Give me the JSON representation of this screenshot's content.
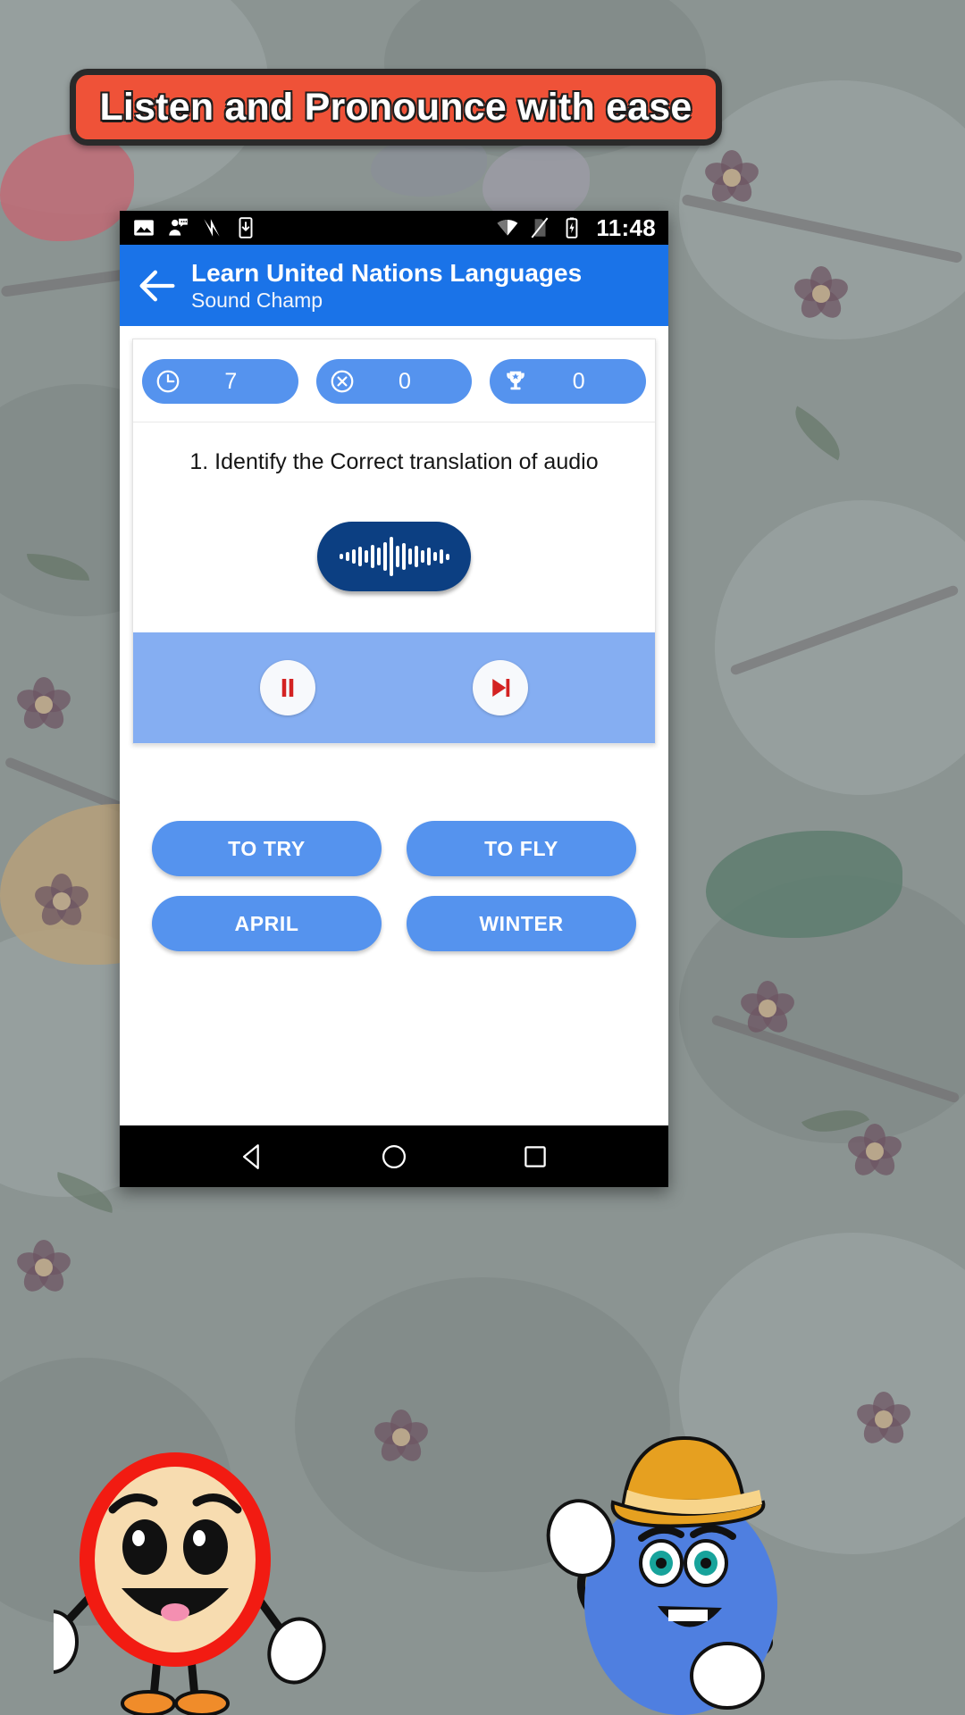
{
  "banner": {
    "text": "Listen and Pronounce with ease",
    "bg_color": "#ef5238",
    "border_color": "#2a2a2a"
  },
  "status_bar": {
    "time": "11:48",
    "left_icons": [
      "image-icon",
      "contact-message-icon",
      "n-logo-icon",
      "download-to-device-icon"
    ],
    "right_icons": [
      "wifi-icon",
      "no-sim-icon",
      "battery-charging-icon"
    ]
  },
  "app_bar": {
    "back_label": "back-arrow",
    "title": "Learn United Nations Languages",
    "subtitle": "Sound Champ",
    "bg_color": "#1a73e8"
  },
  "stats": [
    {
      "icon": "clock-icon",
      "value": "7"
    },
    {
      "icon": "x-circle-icon",
      "value": "0"
    },
    {
      "icon": "trophy-icon",
      "value": "0"
    }
  ],
  "quiz": {
    "question": "1. Identify the Correct translation of  audio",
    "audio_button": "audio-waveform-button",
    "player": {
      "pause_label": "pause-button",
      "next_label": "next-track-button",
      "bg_color": "#85aef2"
    },
    "answers": [
      "TO TRY",
      "TO FLY",
      "APRIL",
      "WINTER"
    ],
    "answer_color": "#5593ee"
  },
  "nav_bar": {
    "back": "back-triangle",
    "home": "home-circle",
    "recents": "recents-square"
  },
  "mascots": [
    {
      "name": "red-character",
      "body_color": "#f7dcb0",
      "outline_color": "#f21b12"
    },
    {
      "name": "blue-character-with-hat",
      "body_color": "#4f7fe0",
      "hat_color": "#e6a020"
    }
  ]
}
